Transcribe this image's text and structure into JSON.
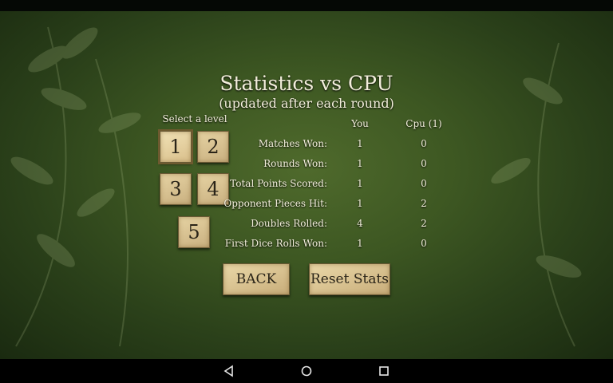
{
  "header": {
    "title": "Statistics vs CPU",
    "subtitle": "(updated after each round)"
  },
  "levels": {
    "label": "Select a level",
    "items": [
      "1",
      "2",
      "3",
      "4",
      "5"
    ],
    "selected": "1"
  },
  "stats": {
    "col_you": "You",
    "col_cpu": "Cpu (1)",
    "rows": [
      {
        "label": "Matches Won:",
        "you": "1",
        "cpu": "0"
      },
      {
        "label": "Rounds Won:",
        "you": "1",
        "cpu": "0"
      },
      {
        "label": "Total Points Scored:",
        "you": "1",
        "cpu": "0"
      },
      {
        "label": "Opponent Pieces Hit:",
        "you": "1",
        "cpu": "2"
      },
      {
        "label": "Doubles Rolled:",
        "you": "4",
        "cpu": "2"
      },
      {
        "label": "First Dice Rolls Won:",
        "you": "1",
        "cpu": "0"
      }
    ]
  },
  "buttons": {
    "back": "BACK",
    "reset": "Reset Stats"
  },
  "navbar": {
    "icons": [
      "back-triangle-icon",
      "home-circle-icon",
      "recents-square-icon"
    ]
  }
}
